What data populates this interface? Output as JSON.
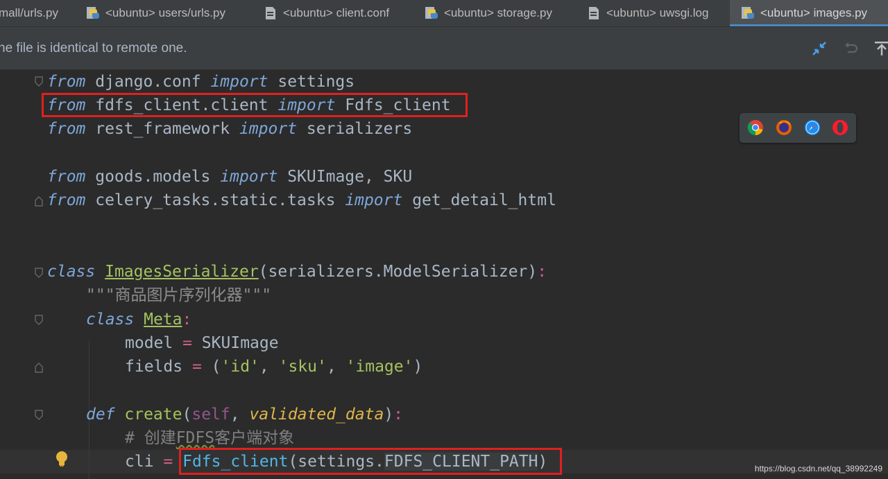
{
  "tabs": [
    {
      "label": "mall/urls.py",
      "icon": "python-file-icon",
      "active": false
    },
    {
      "label": "<ubuntu> users/urls.py",
      "icon": "python-file-icon",
      "active": false
    },
    {
      "label": "<ubuntu> client.conf",
      "icon": "text-file-icon",
      "active": false
    },
    {
      "label": "<ubuntu> storage.py",
      "icon": "python-file-icon",
      "active": false
    },
    {
      "label": "<ubuntu> uwsgi.log",
      "icon": "text-file-icon",
      "active": false
    },
    {
      "label": "<ubuntu> images.py",
      "icon": "python-file-icon",
      "active": true
    }
  ],
  "notice": {
    "text": "he file is identical to remote one.",
    "actions": [
      "compare-icon",
      "revert-icon",
      "upload-icon"
    ]
  },
  "code": {
    "l1": {
      "kw": "from",
      "mod": " django.conf ",
      "imp": "import",
      "name": " settings"
    },
    "l2": {
      "kw": "from",
      "mod": " fdfs_client.client ",
      "imp": "import",
      "name": " Fdfs_client"
    },
    "l3": {
      "kw": "from",
      "mod": " rest_framework ",
      "imp": "import",
      "name": " serializers"
    },
    "l4": {
      "kw": "from",
      "mod": " goods.models ",
      "imp": "import",
      "name": " SKUImage, SKU"
    },
    "l5": {
      "kw": "from",
      "mod": " celery_tasks.static.tasks ",
      "imp": "import",
      "name": " get_detail_html"
    },
    "l6": {
      "kw": "class",
      "cls": "ImagesSerializer",
      "base": "(serializers.ModelSerializer)",
      "colon": ":"
    },
    "l7": {
      "q1": "\"\"\"",
      "doc": "商品图片序列化器",
      "q2": "\"\"\""
    },
    "l8": {
      "kw": "class",
      "cls": "Meta",
      "colon": ":"
    },
    "l9": {
      "name": "model ",
      "eq": "=",
      "val": " SKUImage"
    },
    "l10": {
      "name": "fields ",
      "eq": "=",
      "p1": " (",
      "s1": "'id'",
      "c1": ", ",
      "s2": "'sku'",
      "c2": ", ",
      "s3": "'image'",
      "p2": ")"
    },
    "l11": {
      "kw": "def",
      "fn": " create",
      "p1": "(",
      "self": "self",
      "c": ", ",
      "param": "validated_data",
      "p2": ")",
      "colon": ":"
    },
    "l12": {
      "hash": "# 创建",
      "wavy": "FDFS",
      "rest": "客户端对象"
    },
    "l13": {
      "name": "cli ",
      "eq": "=",
      "sp": " ",
      "cls": "Fdfs_client",
      "arg": "(settings.",
      "const": "FDFS_CLIENT_PATH",
      "close": ")"
    }
  },
  "browsers": [
    "chrome-icon",
    "firefox-icon",
    "safari-icon",
    "opera-icon"
  ],
  "watermark": "https://blog.csdn.net/qq_38992249"
}
